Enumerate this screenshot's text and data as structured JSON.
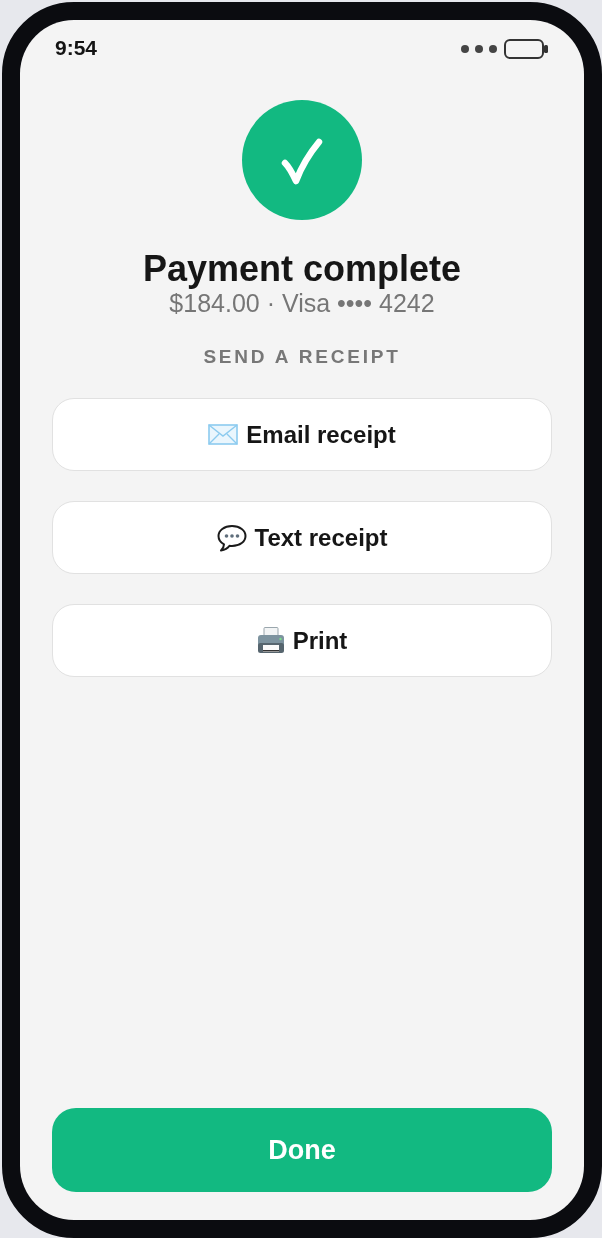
{
  "status_bar": {
    "time": "9:54"
  },
  "header": {
    "title": "Payment complete",
    "subtitle": "$184.00 · Visa •••• 4242"
  },
  "receipt": {
    "heading": "SEND A RECEIPT",
    "options": [
      {
        "kind": "email",
        "label": "Email receipt"
      },
      {
        "kind": "text",
        "label": "Text receipt"
      },
      {
        "kind": "print",
        "label": "Print"
      }
    ]
  },
  "done_button": {
    "label": "Done"
  }
}
